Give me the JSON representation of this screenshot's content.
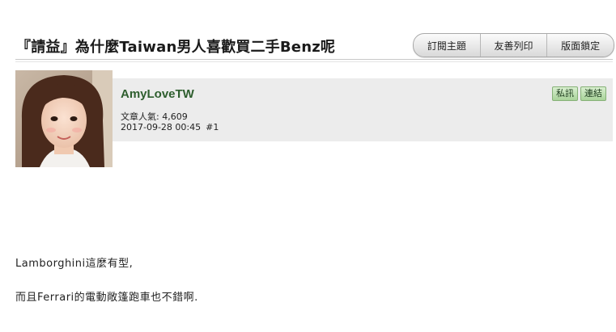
{
  "thread": {
    "title": "『請益』為什麼Taiwan男人喜歡買二手Benz呢"
  },
  "toolbar": {
    "subscribe_label": "訂閱主題",
    "print_label": "友善列印",
    "lock_label": "版面鎖定"
  },
  "post": {
    "username": "AmyLoveTW",
    "popularity": "文章人氣: 4,609",
    "timestamp": "2017-09-28 00:45",
    "floor": "#1",
    "pm_label": "私訊",
    "link_label": "連結",
    "body": [
      "Lamborghini這麼有型,",
      "而且Ferrari的電動敞篷跑車也不錯啊."
    ]
  },
  "colors": {
    "username": "#2e5e2e",
    "info_bg": "#ececec",
    "green_button": "#a9d39a"
  }
}
